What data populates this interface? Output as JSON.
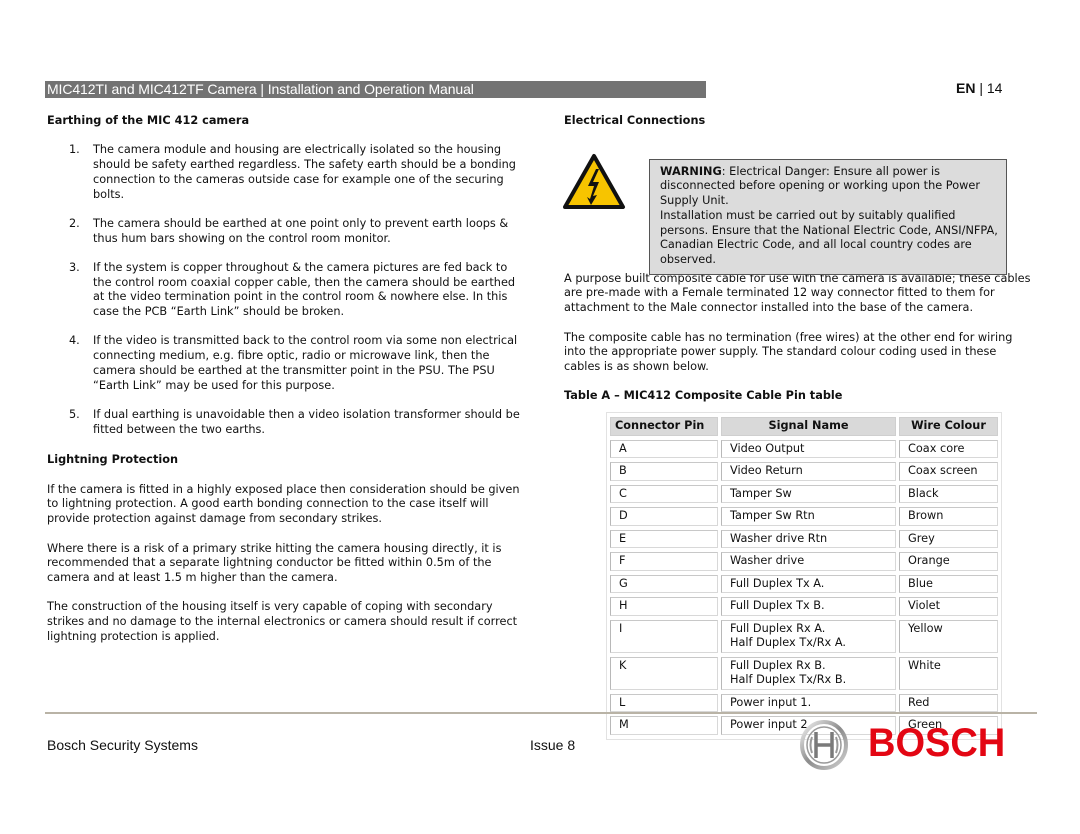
{
  "header": {
    "title": "MIC412TI and MIC412TF Camera | Installation and Operation Manual",
    "lang": "EN",
    "separator": "|",
    "page": "14"
  },
  "left": {
    "earthing_heading": "Earthing of the MIC 412 camera",
    "earthing_items": [
      {
        "num": "1.",
        "text": "The camera module and housing are electrically isolated so the housing should be safety earthed regardless. The safety earth should be a bonding connection to the cameras outside case for example one of the securing bolts."
      },
      {
        "num": "2.",
        "text": "The camera should be earthed at one point only to prevent earth loops & thus hum bars showing on the control room monitor."
      },
      {
        "num": "3.",
        "text": "If the system is copper throughout & the camera pictures are fed back to the control room coaxial copper cable, then the camera should be earthed at the video termination point in the control room & nowhere else. In this case the PCB “Earth Link” should be broken."
      },
      {
        "num": "4.",
        "text": "If the video is transmitted back to the control room via some non electrical connecting medium, e.g. fibre optic, radio or microwave link, then the camera should be earthed at the transmitter point in the PSU. The PSU “Earth Link” may be used for this purpose."
      },
      {
        "num": "5.",
        "text": "If dual earthing is unavoidable then a video isolation transformer should be fitted between the two earths."
      }
    ],
    "lightning_heading": "Lightning Protection",
    "lightning_paragraphs": [
      "If the camera is fitted in a highly exposed place then consideration should be given to lightning protection. A good earth bonding connection to the case itself will provide protection against damage from secondary strikes.",
      "Where there is a risk of a primary strike hitting the camera housing directly, it is recommended that a separate lightning conductor be fitted within 0.5m of the camera and at least 1.5 m higher than the camera.",
      "The construction of the housing itself is very capable of coping with secondary strikes and no damage to the internal electronics or camera should result if correct lightning protection is applied."
    ]
  },
  "right": {
    "electrical_heading": "Electrical Connections",
    "warning_icon": "electrical-hazard-icon",
    "warning_label": "WARNING",
    "warning_line1": ": Electrical Danger: Ensure all power is disconnected before opening or working upon the Power Supply Unit.",
    "warning_line2": "Installation must be carried out by suitably qualified persons. Ensure that the National Electric Code, ANSI/NFPA, Canadian Electric Code, and all local country codes are observed.",
    "paragraphs": [
      "A purpose built composite cable for use with the camera is available; these cables are pre-made with a Female terminated 12 way connector fitted to them for attachment to the Male connector installed into the base of the camera.",
      "The composite cable has no termination (free wires) at the other end for wiring into the appropriate power supply. The standard colour coding used in these cables is as shown below."
    ],
    "table_caption": "Table A – MIC412 Composite Cable Pin table",
    "table": {
      "headers": [
        "Connector Pin",
        "Signal Name",
        "Wire Colour"
      ],
      "rows": [
        {
          "pin": "A",
          "signal": "Video Output",
          "signal2": "",
          "colour": "Coax core"
        },
        {
          "pin": "B",
          "signal": "Video Return",
          "signal2": "",
          "colour": "Coax screen"
        },
        {
          "pin": "C",
          "signal": "Tamper Sw",
          "signal2": "",
          "colour": "Black"
        },
        {
          "pin": "D",
          "signal": "Tamper Sw Rtn",
          "signal2": "",
          "colour": "Brown"
        },
        {
          "pin": "E",
          "signal": "Washer drive Rtn",
          "signal2": "",
          "colour": "Grey"
        },
        {
          "pin": "F",
          "signal": "Washer drive",
          "signal2": "",
          "colour": "Orange"
        },
        {
          "pin": "G",
          "signal": "Full Duplex Tx A.",
          "signal2": "",
          "colour": "Blue"
        },
        {
          "pin": "H",
          "signal": "Full Duplex Tx B.",
          "signal2": "",
          "colour": "Violet"
        },
        {
          "pin": "I",
          "signal": "Full Duplex Rx A.",
          "signal2": "Half Duplex Tx/Rx A.",
          "colour": "Yellow"
        },
        {
          "pin": "K",
          "signal": "Full Duplex Rx B.",
          "signal2": "Half Duplex Tx/Rx B.",
          "colour": "White"
        },
        {
          "pin": "L",
          "signal": "Power input 1.",
          "signal2": "",
          "colour": "Red"
        },
        {
          "pin": "M",
          "signal": "Power input 2.",
          "signal2": "",
          "colour": "Green"
        }
      ]
    }
  },
  "footer": {
    "company": "Bosch Security Systems",
    "issue": "Issue 8",
    "brand": "BOSCH",
    "brand_color": "#e30613"
  }
}
